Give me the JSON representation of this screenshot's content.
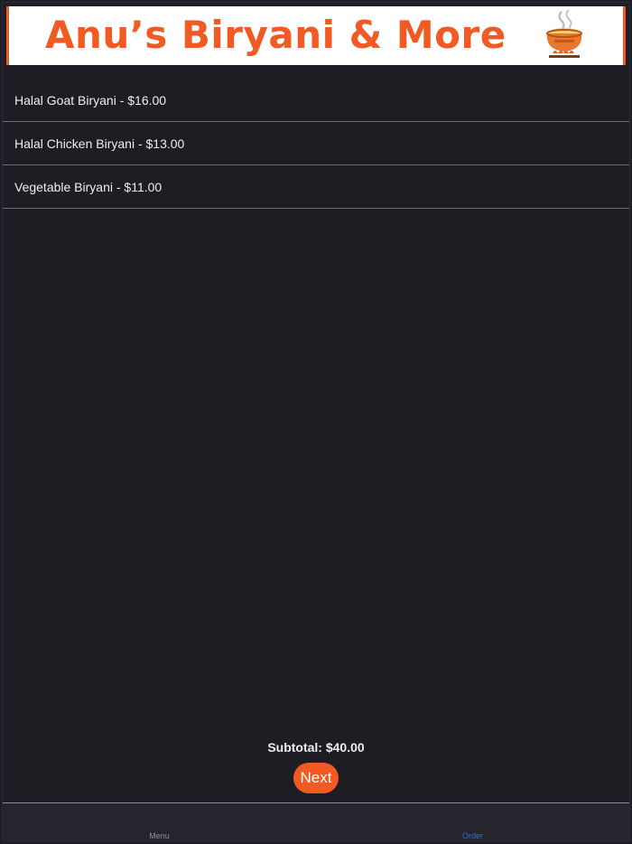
{
  "banner": {
    "title": "Anu’s Biryani & More",
    "icon": "biryani-pot-icon"
  },
  "menu": {
    "items": [
      {
        "label": "Halal Goat Biryani - $16.00"
      },
      {
        "label": "Halal Chicken Biryani - $13.00"
      },
      {
        "label": "Vegetable Biryani - $11.00"
      }
    ]
  },
  "order": {
    "subtotal": "Subtotal: $40.00",
    "next_label": "Next"
  },
  "tab_bar": {
    "tabs": [
      {
        "label": "Menu",
        "active": false
      },
      {
        "label": "Order",
        "active": true
      }
    ]
  },
  "colors": {
    "background": "#1e1d23",
    "accent": "#f15a22",
    "active_tab": "#2f6fe4",
    "inactive_tab": "#8e8e93"
  }
}
